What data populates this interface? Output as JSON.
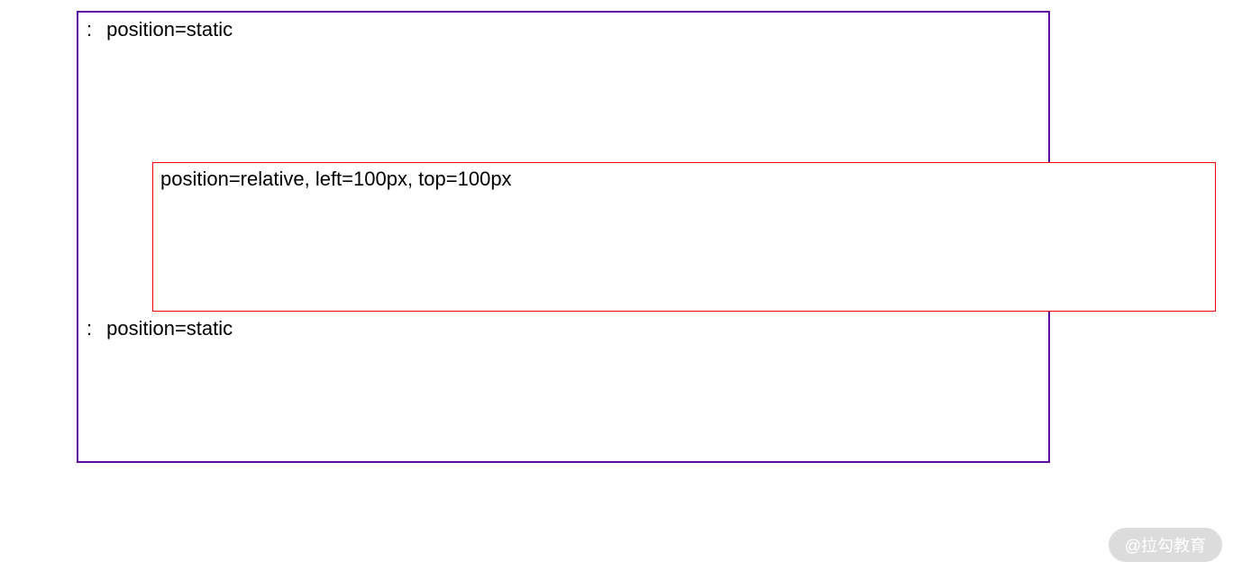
{
  "blocks": {
    "static1": {
      "prefix": ":",
      "label": "position=static"
    },
    "relative": {
      "label": "position=relative, left=100px, top=100px"
    },
    "static2": {
      "prefix": ":",
      "label": "position=static"
    }
  },
  "watermark": "@拉勾教育",
  "colors": {
    "container_border": "#5b0d9e",
    "relative_border": "#ff0000"
  }
}
